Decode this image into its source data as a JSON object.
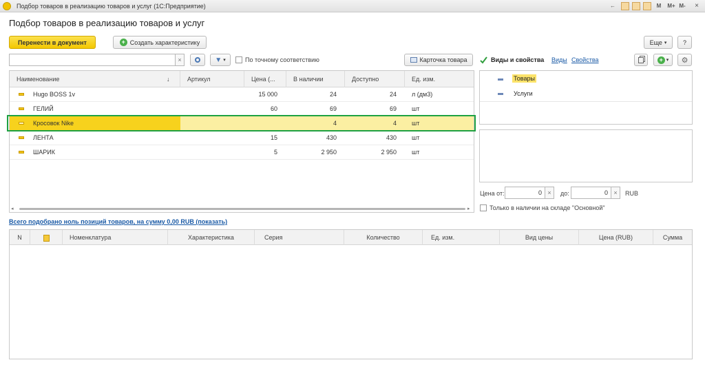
{
  "window": {
    "title": "Подбор товаров в реализацию товаров и услуг  (1С:Предприятие)",
    "tool_m": "M",
    "tool_mplus": "M+",
    "tool_mminus": "M-",
    "minimize": "–",
    "maximize": "□",
    "close": "×"
  },
  "form": {
    "title": "Подбор товаров в реализацию товаров и услуг"
  },
  "toolbar": {
    "transfer_label": "Перенести в документ",
    "create_char_label": "Создать характеристику",
    "more_label": "Еще",
    "help_label": "?"
  },
  "search": {
    "value": "",
    "clear": "×",
    "exact_match_label": "По точному соответствию",
    "product_card_label": "Карточка товара"
  },
  "goods_table": {
    "columns": {
      "name": "Наименование",
      "sort_arrow": "↓",
      "article": "Артикул",
      "price": "Цена (...",
      "in_stock": "В наличии",
      "available": "Доступно",
      "unit": "Ед. изм."
    },
    "rows": [
      {
        "name": "Hugo BOSS 1v",
        "article": "",
        "price": "15 000",
        "in_stock": "24",
        "available": "24",
        "unit": "л (дм3)"
      },
      {
        "name": "ГЕЛИЙ",
        "article": "",
        "price": "60",
        "in_stock": "69",
        "available": "69",
        "unit": "шт"
      },
      {
        "name": "Кросовок Nike",
        "article": "",
        "price": "",
        "in_stock": "4",
        "available": "4",
        "unit": "шт"
      },
      {
        "name": "ЛЕНТА",
        "article": "",
        "price": "15",
        "in_stock": "430",
        "available": "430",
        "unit": "шт"
      },
      {
        "name": "ШАРИК",
        "article": "",
        "price": "5",
        "in_stock": "2 950",
        "available": "2 950",
        "unit": "шт"
      }
    ],
    "selected_row": 2
  },
  "right_panel": {
    "kinds_props_label": "Виды и свойства",
    "link_kinds": "Виды",
    "link_props": "Свойства",
    "tree": [
      "Товары",
      "Услуги"
    ],
    "price_from_label": "Цена от:",
    "price_from_value": "0",
    "price_to_label": "до:",
    "price_to_value": "0",
    "currency": "RUB",
    "clear": "×",
    "only_in_stock_label": "Только в наличии на складе \"Основной\""
  },
  "summary": {
    "text": "Всего подобрано ноль позиций товаров, на сумму 0,00 RUB (показать)"
  },
  "selected_table": {
    "columns": [
      "N",
      "",
      "Номенклатура",
      "Характеристика",
      "Серия",
      "Количество",
      "Ед. изм.",
      "Вид цены",
      "Цена (RUB)",
      "Сумма"
    ]
  },
  "colors": {
    "accent_yellow": "#f3c700",
    "selection_yellow": "#f7d21d",
    "highlight_green": "#1ea142",
    "link_blue": "#1a5aa6"
  }
}
